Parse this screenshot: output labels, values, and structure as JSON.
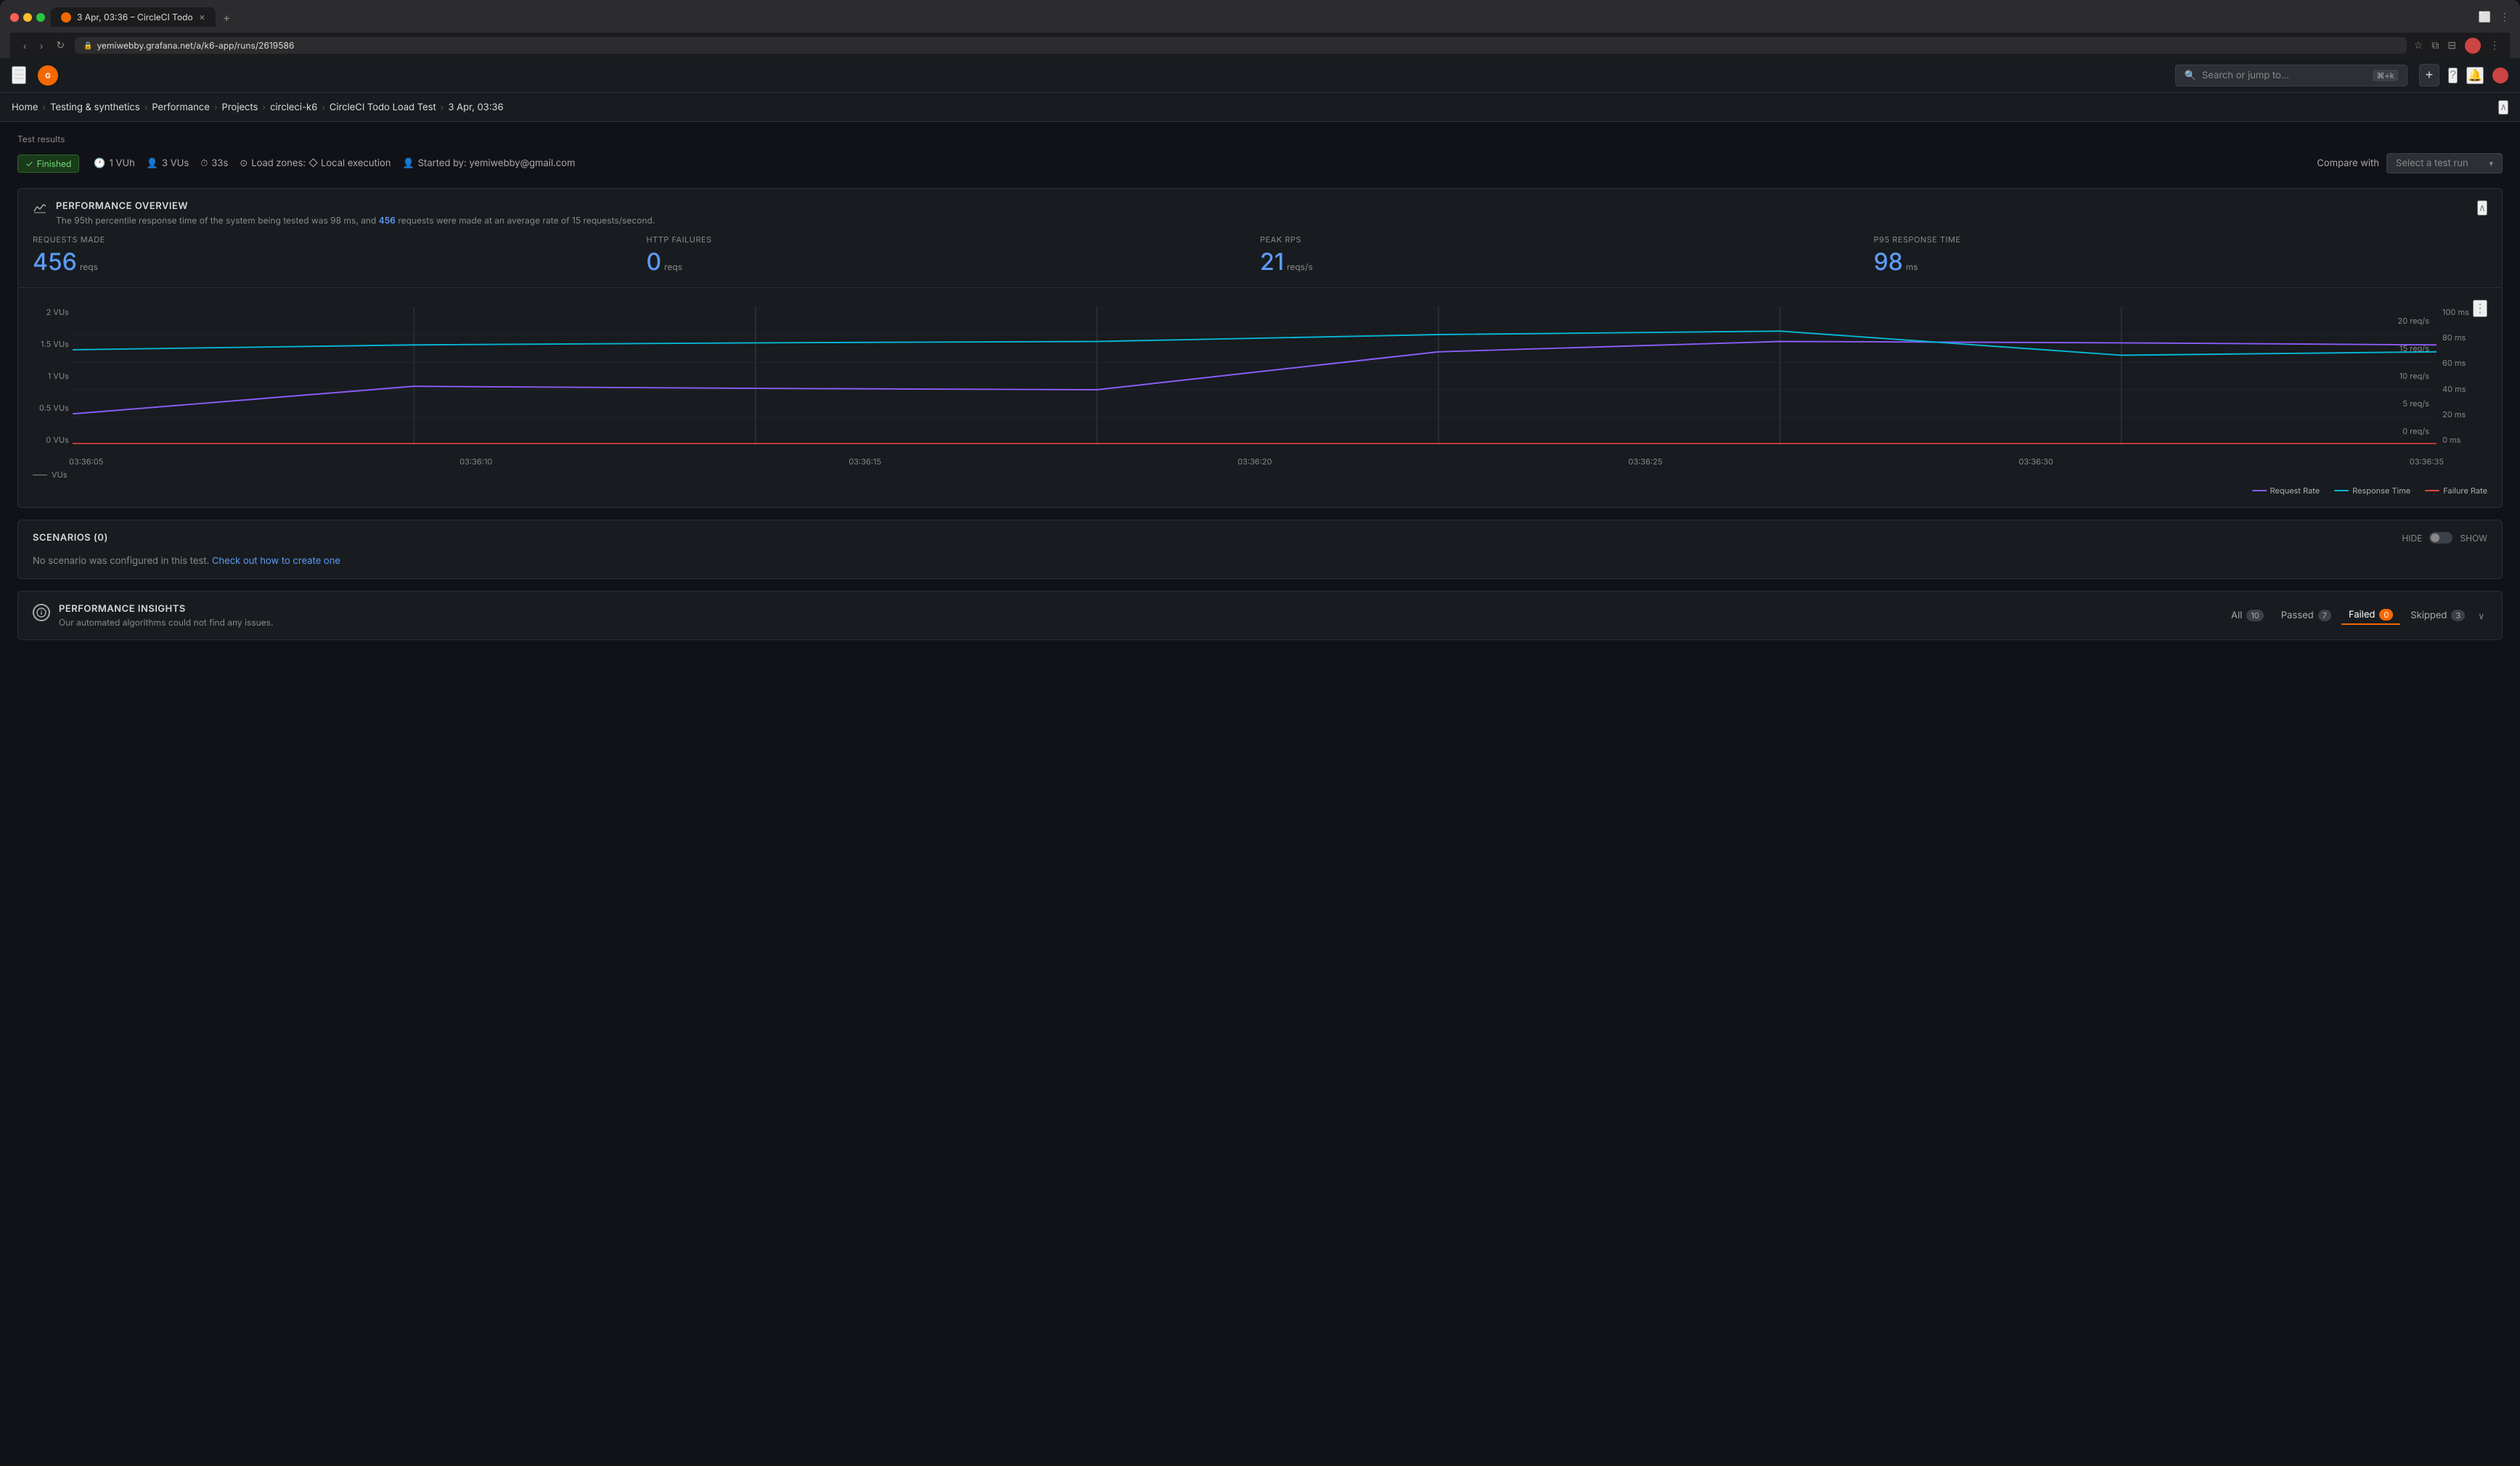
{
  "browser": {
    "tab_title": "3 Apr, 03:36 – CircleCI Todo",
    "url": "yemiwebby.grafana.net/a/k6-app/runs/2619586",
    "new_tab_label": "+"
  },
  "topnav": {
    "search_placeholder": "Search or jump to...",
    "search_shortcut": "⌘+k",
    "plus_label": "+"
  },
  "breadcrumb": {
    "items": [
      "Home",
      "Testing & synthetics",
      "Performance",
      "Projects",
      "circleci-k6",
      "CircleCI Todo Load Test",
      "3 Apr, 03:36"
    ]
  },
  "page": {
    "test_results_label": "Test results"
  },
  "run_info": {
    "status": "Finished",
    "vuh": "1 VUh",
    "vus": "3 VUs",
    "duration": "33s",
    "load_zones": "Load zones: ◇ Local execution",
    "started_by": "Started by: yemiwebby@gmail.com",
    "compare_with_label": "Compare with",
    "compare_select_placeholder": "Select a test run"
  },
  "performance_overview": {
    "title": "PERFORMANCE OVERVIEW",
    "subtitle_prefix": "The 95th percentile response time of the system being tested was 98 ms, and ",
    "subtitle_highlight": "456",
    "subtitle_suffix": " requests were made at an average rate of 15 requests/second.",
    "stats": [
      {
        "label": "REQUESTS MADE",
        "value": "456",
        "unit": "reqs"
      },
      {
        "label": "HTTP FAILURES",
        "value": "0",
        "unit": "reqs"
      },
      {
        "label": "PEAK RPS",
        "value": "21",
        "unit": "reqs/s"
      },
      {
        "label": "P95 RESPONSE TIME",
        "value": "98",
        "unit": "ms"
      }
    ]
  },
  "chart": {
    "y_axis_left": [
      "2 VUs",
      "1.5 VUs",
      "1 VUs",
      "0.5 VUs",
      "0 VUs"
    ],
    "y_axis_right_reqs": [
      "20 req/s",
      "15 req/s",
      "10 req/s",
      "5 req/s",
      "0 req/s"
    ],
    "y_axis_right_ms": [
      "100 ms",
      "80 ms",
      "60 ms",
      "40 ms",
      "20 ms",
      "0 ms"
    ],
    "x_axis": [
      "03:36:05",
      "03:36:10",
      "03:36:15",
      "03:36:20",
      "03:36:25",
      "03:36:30",
      "03:36:35"
    ],
    "vu_label": "VUs",
    "legend": [
      {
        "label": "Request Rate",
        "color": "#8b5cf6"
      },
      {
        "label": "Response Time",
        "color": "#06b6d4"
      },
      {
        "label": "Failure Rate",
        "color": "#ef4444"
      }
    ]
  },
  "scenarios": {
    "title": "SCENARIOS (0)",
    "hide_label": "HIDE",
    "show_label": "SHOW",
    "empty_text": "No scenario was configured in this test.",
    "link_text": "Check out how to create one"
  },
  "insights": {
    "title": "PERFORMANCE INSIGHTS",
    "subtitle": "Our automated algorithms could not find any issues.",
    "tabs": [
      {
        "label": "All",
        "count": "10",
        "active": false
      },
      {
        "label": "Passed",
        "count": "7",
        "active": false
      },
      {
        "label": "Failed",
        "count": "0",
        "active": true
      },
      {
        "label": "Skipped",
        "count": "3",
        "active": false
      }
    ]
  },
  "colors": {
    "accent": "#f46800",
    "blue": "#5b9cf6",
    "green": "#73d977",
    "purple": "#8b5cf6",
    "cyan": "#06b6d4",
    "red": "#ef4444"
  }
}
